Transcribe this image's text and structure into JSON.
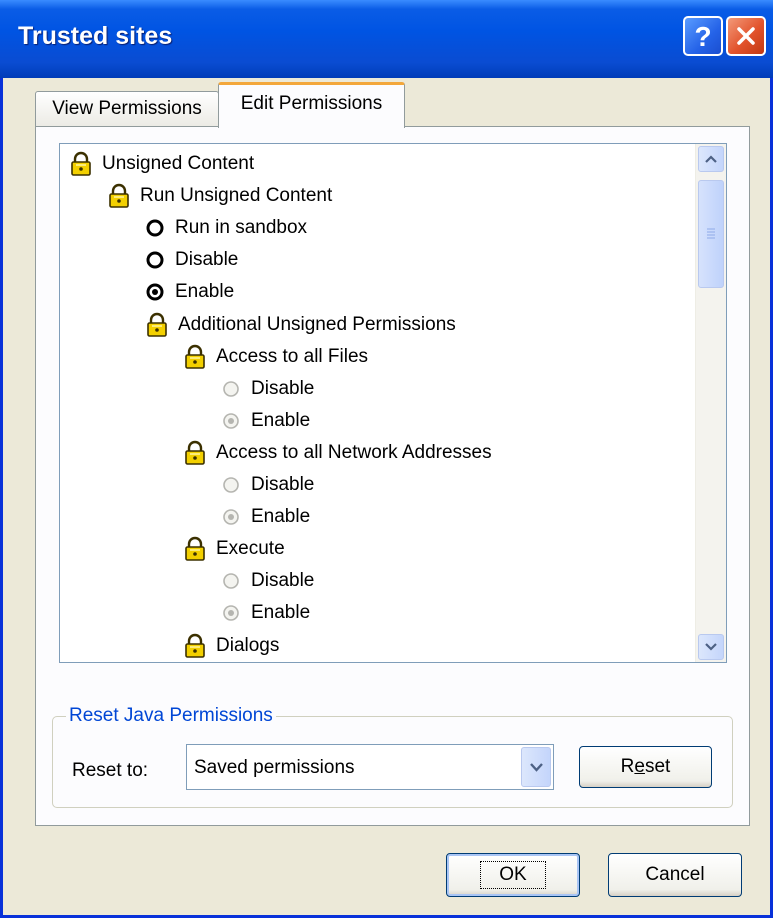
{
  "window": {
    "title": "Trusted sites"
  },
  "tabs": [
    {
      "label": "View Permissions",
      "active": false
    },
    {
      "label": "Edit Permissions",
      "active": true
    }
  ],
  "tree": {
    "items": [
      {
        "type": "lock",
        "label": "Unsigned Content"
      },
      {
        "type": "lock",
        "label": "Run Unsigned Content"
      },
      {
        "type": "radio",
        "label": "Run in sandbox",
        "checked": false,
        "enabled": true
      },
      {
        "type": "radio",
        "label": "Disable",
        "checked": false,
        "enabled": true
      },
      {
        "type": "radio",
        "label": "Enable",
        "checked": true,
        "enabled": true
      },
      {
        "type": "lock",
        "label": "Additional Unsigned Permissions"
      },
      {
        "type": "lock",
        "label": "Access to all Files"
      },
      {
        "type": "radio",
        "label": "Disable",
        "checked": false,
        "enabled": false
      },
      {
        "type": "radio",
        "label": "Enable",
        "checked": true,
        "enabled": false
      },
      {
        "type": "lock",
        "label": "Access to all Network Addresses"
      },
      {
        "type": "radio",
        "label": "Disable",
        "checked": false,
        "enabled": false
      },
      {
        "type": "radio",
        "label": "Enable",
        "checked": true,
        "enabled": false
      },
      {
        "type": "lock",
        "label": "Execute"
      },
      {
        "type": "radio",
        "label": "Disable",
        "checked": false,
        "enabled": false
      },
      {
        "type": "radio",
        "label": "Enable",
        "checked": true,
        "enabled": false
      },
      {
        "type": "lock",
        "label": "Dialogs"
      }
    ]
  },
  "reset_group": {
    "legend": "Reset Java Permissions",
    "reset_to_label": "Reset to:",
    "selected": "Saved permissions",
    "reset_button": {
      "before": "R",
      "underline": "e",
      "after": "set"
    }
  },
  "footer": {
    "ok_label": "OK",
    "cancel_label": "Cancel"
  },
  "colors": {
    "titlebar": "#0054e3",
    "accent_tab": "#f3a73b",
    "group_legend": "#0046d5",
    "dialog_face": "#ece9d8"
  }
}
